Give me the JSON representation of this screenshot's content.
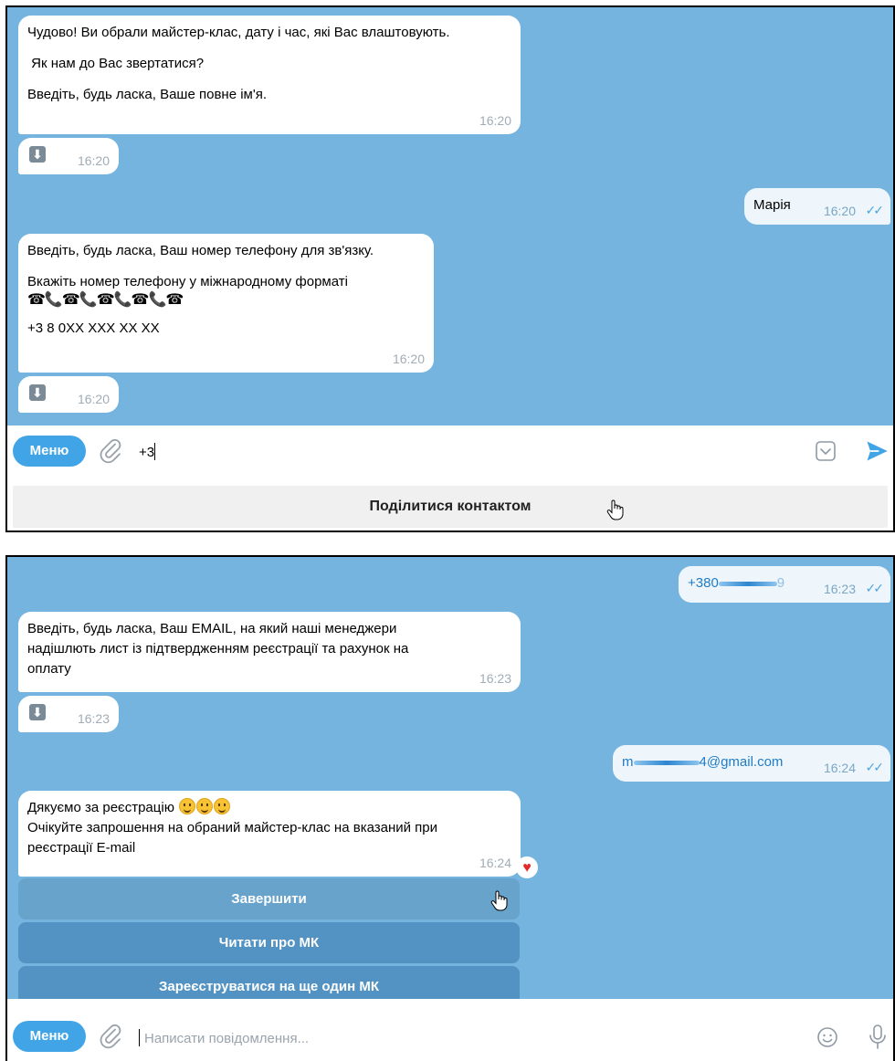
{
  "panel1": {
    "messages": [
      {
        "lines": [
          "Чудово! Ви обрали майстер-клас, дату і час, які Вас влаштовують.",
          "",
          " Як нам до Вас звертатися?",
          "",
          "Введіть, будь ласка, Ваше повне ім'я."
        ],
        "time": "16:20"
      },
      {
        "time": "16:20"
      },
      {
        "text": "Марія",
        "time": "16:20"
      },
      {
        "lines": [
          "Введіть, будь ласка, Ваш номер телефону для зв'язку.",
          "",
          "Вкажіть номер телефону у міжнародному форматі"
        ],
        "emoji_row": "☎📞☎📞☎📞☎📞☎",
        "last_line": "+3 8 0XX XXX XX XX",
        "time": "16:20"
      },
      {
        "time": "16:20"
      }
    ],
    "composer": {
      "menu_label": "Меню",
      "input_value": "+3"
    },
    "share_contact_label": "Поділитися контактом"
  },
  "panel2": {
    "messages": [
      {
        "text_start": "+380",
        "text_end": "9",
        "time": "16:23"
      },
      {
        "lines": [
          "Введіть, будь ласка, Ваш EMAIL, на який наші менеджери",
          "надішлють лист із підтвердженням реєстрації та рахунок на",
          "оплату"
        ],
        "time": "16:23"
      },
      {
        "time": "16:23"
      },
      {
        "text_start": "m",
        "text_end": "4@gmail.com",
        "time": "16:24"
      },
      {
        "line1": "Дякуємо за реєстрацію",
        "line2": "Очікуйте запрошення на обраний майстер-клас на вказаний при",
        "line3": "реєстрації E-mail",
        "time": "16:24",
        "reaction": "♥"
      }
    ],
    "buttons": [
      "Завершити",
      "Читати про МК",
      "Зареєструватися на ще один МК"
    ],
    "composer": {
      "menu_label": "Меню",
      "placeholder": "Написати повідомлення..."
    }
  },
  "colors": {
    "chat_background": "#76b4e0",
    "accent": "#40a4e6",
    "inline_button": "#5293c4",
    "reaction": "#e22a2a"
  },
  "icons": [
    "download-icon",
    "paperclip-icon",
    "emoji-keyboard-icon",
    "send-icon",
    "emoji-icon",
    "microphone-icon",
    "read-ticks-icon",
    "hand-cursor-icon"
  ]
}
